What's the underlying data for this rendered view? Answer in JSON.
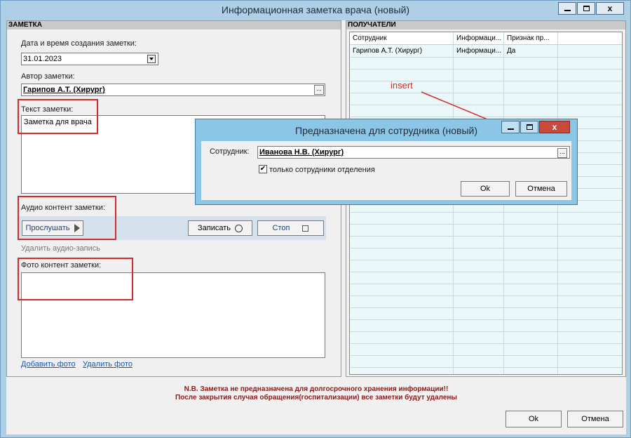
{
  "window": {
    "title": "Информационная заметка врача (новый)"
  },
  "note_group": {
    "header": "ЗАМЕТКА",
    "date_label": "Дата и время создания заметки:",
    "date_value": "31.01.2023",
    "author_label": "Автор заметки:",
    "author_value": "Гарипов А.Т. (Хирург)",
    "text_label": "Текст заметки:",
    "text_value": "Заметка для врача",
    "audio_label": "Аудио контент заметки:",
    "play_label": "Прослушать",
    "record_label": "Записать",
    "stop_label": "Стоп",
    "delete_audio_label": "Удалить аудио-запись",
    "photo_label": "Фото контент заметки:",
    "add_photo_label": "Добавить фото",
    "delete_photo_label": "Удалить фото"
  },
  "recipients": {
    "header": "ПОЛУЧАТЕЛИ",
    "columns": [
      "Сотрудник",
      "Информаци...",
      "Признак пр..."
    ],
    "rows": [
      {
        "employee": "Гарипов А.Т. (Хирург)",
        "info": "Информаци...",
        "sign": "Да"
      }
    ]
  },
  "warning": {
    "line1": "N.B. Заметка не предназначена для долгосрочного хранения информации!!",
    "line2": "После закрытия случая обращения(госпитализации) все заметки будут удалены"
  },
  "footer": {
    "ok_label": "Ok",
    "cancel_label": "Отмена"
  },
  "dialog": {
    "title": "Предназначена для сотрудника (новый)",
    "employee_label": "Сотрудник:",
    "employee_value": "Иванова Н.В. (Хирург)",
    "checkbox_label": "только сотрудники отделения",
    "checkbox_checked": true,
    "ok_label": "Ok",
    "cancel_label": "Отмена"
  },
  "annotation": {
    "text": "insert",
    "color": "#d42a2a"
  }
}
